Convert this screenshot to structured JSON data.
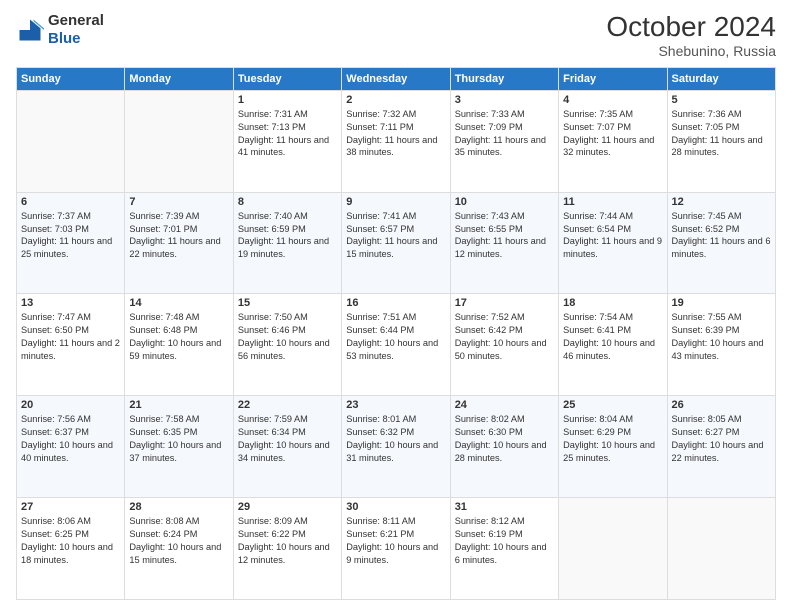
{
  "logo": {
    "general": "General",
    "blue": "Blue"
  },
  "header": {
    "month_year": "October 2024",
    "location": "Shebunino, Russia"
  },
  "weekdays": [
    "Sunday",
    "Monday",
    "Tuesday",
    "Wednesday",
    "Thursday",
    "Friday",
    "Saturday"
  ],
  "weeks": [
    [
      {
        "day": "",
        "content": ""
      },
      {
        "day": "",
        "content": ""
      },
      {
        "day": "1",
        "content": "Sunrise: 7:31 AM\nSunset: 7:13 PM\nDaylight: 11 hours and 41 minutes."
      },
      {
        "day": "2",
        "content": "Sunrise: 7:32 AM\nSunset: 7:11 PM\nDaylight: 11 hours and 38 minutes."
      },
      {
        "day": "3",
        "content": "Sunrise: 7:33 AM\nSunset: 7:09 PM\nDaylight: 11 hours and 35 minutes."
      },
      {
        "day": "4",
        "content": "Sunrise: 7:35 AM\nSunset: 7:07 PM\nDaylight: 11 hours and 32 minutes."
      },
      {
        "day": "5",
        "content": "Sunrise: 7:36 AM\nSunset: 7:05 PM\nDaylight: 11 hours and 28 minutes."
      }
    ],
    [
      {
        "day": "6",
        "content": "Sunrise: 7:37 AM\nSunset: 7:03 PM\nDaylight: 11 hours and 25 minutes."
      },
      {
        "day": "7",
        "content": "Sunrise: 7:39 AM\nSunset: 7:01 PM\nDaylight: 11 hours and 22 minutes."
      },
      {
        "day": "8",
        "content": "Sunrise: 7:40 AM\nSunset: 6:59 PM\nDaylight: 11 hours and 19 minutes."
      },
      {
        "day": "9",
        "content": "Sunrise: 7:41 AM\nSunset: 6:57 PM\nDaylight: 11 hours and 15 minutes."
      },
      {
        "day": "10",
        "content": "Sunrise: 7:43 AM\nSunset: 6:55 PM\nDaylight: 11 hours and 12 minutes."
      },
      {
        "day": "11",
        "content": "Sunrise: 7:44 AM\nSunset: 6:54 PM\nDaylight: 11 hours and 9 minutes."
      },
      {
        "day": "12",
        "content": "Sunrise: 7:45 AM\nSunset: 6:52 PM\nDaylight: 11 hours and 6 minutes."
      }
    ],
    [
      {
        "day": "13",
        "content": "Sunrise: 7:47 AM\nSunset: 6:50 PM\nDaylight: 11 hours and 2 minutes."
      },
      {
        "day": "14",
        "content": "Sunrise: 7:48 AM\nSunset: 6:48 PM\nDaylight: 10 hours and 59 minutes."
      },
      {
        "day": "15",
        "content": "Sunrise: 7:50 AM\nSunset: 6:46 PM\nDaylight: 10 hours and 56 minutes."
      },
      {
        "day": "16",
        "content": "Sunrise: 7:51 AM\nSunset: 6:44 PM\nDaylight: 10 hours and 53 minutes."
      },
      {
        "day": "17",
        "content": "Sunrise: 7:52 AM\nSunset: 6:42 PM\nDaylight: 10 hours and 50 minutes."
      },
      {
        "day": "18",
        "content": "Sunrise: 7:54 AM\nSunset: 6:41 PM\nDaylight: 10 hours and 46 minutes."
      },
      {
        "day": "19",
        "content": "Sunrise: 7:55 AM\nSunset: 6:39 PM\nDaylight: 10 hours and 43 minutes."
      }
    ],
    [
      {
        "day": "20",
        "content": "Sunrise: 7:56 AM\nSunset: 6:37 PM\nDaylight: 10 hours and 40 minutes."
      },
      {
        "day": "21",
        "content": "Sunrise: 7:58 AM\nSunset: 6:35 PM\nDaylight: 10 hours and 37 minutes."
      },
      {
        "day": "22",
        "content": "Sunrise: 7:59 AM\nSunset: 6:34 PM\nDaylight: 10 hours and 34 minutes."
      },
      {
        "day": "23",
        "content": "Sunrise: 8:01 AM\nSunset: 6:32 PM\nDaylight: 10 hours and 31 minutes."
      },
      {
        "day": "24",
        "content": "Sunrise: 8:02 AM\nSunset: 6:30 PM\nDaylight: 10 hours and 28 minutes."
      },
      {
        "day": "25",
        "content": "Sunrise: 8:04 AM\nSunset: 6:29 PM\nDaylight: 10 hours and 25 minutes."
      },
      {
        "day": "26",
        "content": "Sunrise: 8:05 AM\nSunset: 6:27 PM\nDaylight: 10 hours and 22 minutes."
      }
    ],
    [
      {
        "day": "27",
        "content": "Sunrise: 8:06 AM\nSunset: 6:25 PM\nDaylight: 10 hours and 18 minutes."
      },
      {
        "day": "28",
        "content": "Sunrise: 8:08 AM\nSunset: 6:24 PM\nDaylight: 10 hours and 15 minutes."
      },
      {
        "day": "29",
        "content": "Sunrise: 8:09 AM\nSunset: 6:22 PM\nDaylight: 10 hours and 12 minutes."
      },
      {
        "day": "30",
        "content": "Sunrise: 8:11 AM\nSunset: 6:21 PM\nDaylight: 10 hours and 9 minutes."
      },
      {
        "day": "31",
        "content": "Sunrise: 8:12 AM\nSunset: 6:19 PM\nDaylight: 10 hours and 6 minutes."
      },
      {
        "day": "",
        "content": ""
      },
      {
        "day": "",
        "content": ""
      }
    ]
  ]
}
